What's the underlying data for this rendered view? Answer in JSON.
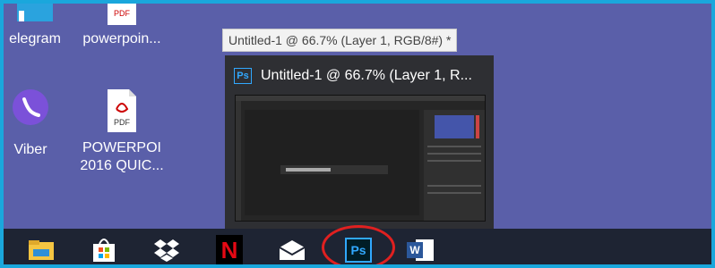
{
  "desktop": {
    "icons": [
      {
        "label_lines": [
          "elegram"
        ],
        "icon": "telegram-icon"
      },
      {
        "label_lines": [
          "powerpoin..."
        ],
        "icon": "pdf-file-icon"
      },
      {
        "label_lines": [
          "Viber"
        ],
        "icon": "viber-icon"
      },
      {
        "label_lines": [
          "POWERPOI",
          "2016 QUIC..."
        ],
        "icon": "pdf-file-icon"
      }
    ],
    "pdf_badge_text": "PDF"
  },
  "tooltip": {
    "text": "Untitled-1 @ 66.7% (Layer 1, RGB/8#) *"
  },
  "preview": {
    "app_badge": "Ps",
    "title": "Untitled-1 @ 66.7% (Layer 1, R..."
  },
  "taskbar": {
    "items": [
      {
        "icon": "file-explorer-icon"
      },
      {
        "icon": "microsoft-store-icon"
      },
      {
        "icon": "dropbox-icon"
      },
      {
        "icon": "netflix-icon",
        "text": "N"
      },
      {
        "icon": "mail-icon"
      },
      {
        "icon": "photoshop-icon",
        "text": "Ps",
        "highlighted": true
      },
      {
        "icon": "word-icon",
        "text": "W"
      }
    ]
  },
  "colors": {
    "desktop_bg": "#5a5fa9",
    "frame_border": "#1aa7dc",
    "taskbar_bg": "#1e2433",
    "highlight_circle": "#e02020",
    "photoshop_blue": "#31a8ff"
  }
}
